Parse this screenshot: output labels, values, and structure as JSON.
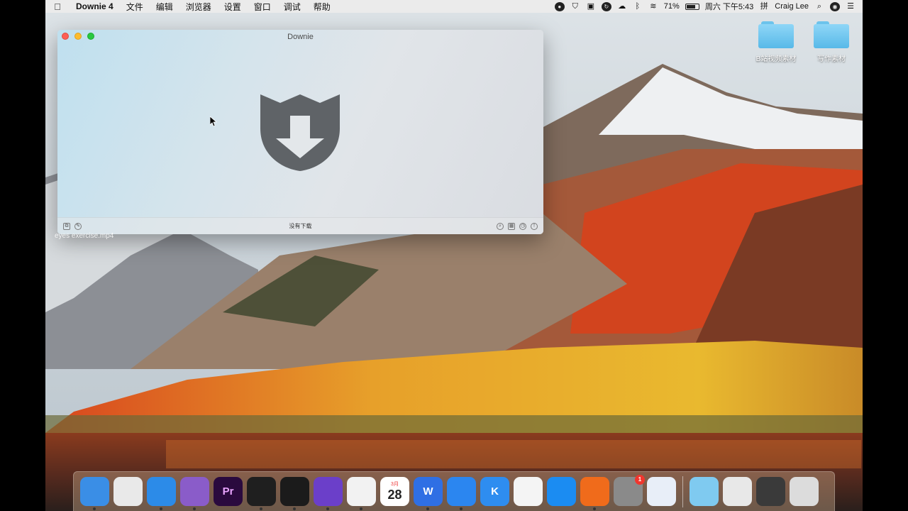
{
  "menubar": {
    "app_name": "Downie 4",
    "items": [
      "文件",
      "编辑",
      "浏览器",
      "设置",
      "窗口",
      "调试",
      "帮助"
    ],
    "battery_percent": "71%",
    "datetime": "周六 下午5:43",
    "user": "Craig Lee"
  },
  "desktop": {
    "folders": [
      {
        "label": "B站视频素材"
      },
      {
        "label": "写作素材"
      }
    ],
    "file_label": "eyes exercise.mp4"
  },
  "window": {
    "title": "Downie",
    "status": "没有下载"
  },
  "dock": {
    "apps": [
      {
        "name": "finder-icon",
        "color": "#3a8ee6"
      },
      {
        "name": "chrome-icon",
        "color": "#e9e9e9"
      },
      {
        "name": "safari-icon",
        "color": "#2c8be8"
      },
      {
        "name": "downie-icon",
        "color": "#8a5cc9"
      },
      {
        "name": "premiere-icon",
        "color": "#2a0a3e",
        "text": "Pr"
      },
      {
        "name": "video-camera-icon",
        "color": "#1f1f1f"
      },
      {
        "name": "quicktime-icon",
        "color": "#1b1b1b"
      },
      {
        "name": "imovie-icon",
        "color": "#6b3fc9"
      },
      {
        "name": "qq-icon",
        "color": "#f2f2f2"
      },
      {
        "name": "calendar-icon",
        "color": "#ffffff",
        "month": "3月",
        "day": "28"
      },
      {
        "name": "wps-icon",
        "color": "#2f6fe4",
        "text": "W"
      },
      {
        "name": "feishu-icon",
        "color": "#2b86f0"
      },
      {
        "name": "klook-icon",
        "color": "#2e8df0",
        "text": "K"
      },
      {
        "name": "baidu-netdisk-icon",
        "color": "#f4f4f4"
      },
      {
        "name": "app-store-icon",
        "color": "#1b8cf2"
      },
      {
        "name": "infuse-icon",
        "color": "#f06b1b"
      },
      {
        "name": "system-preferences-icon",
        "color": "#8a8a8a",
        "badge": "1"
      },
      {
        "name": "airmail-icon",
        "color": "#e8eef8"
      }
    ],
    "stacks": [
      {
        "name": "downloads-stack-icon",
        "color": "#7fcaf0"
      },
      {
        "name": "documents-stack-icon",
        "color": "#e8e8e8"
      },
      {
        "name": "screenshots-stack-icon",
        "color": "#3a3a3a"
      },
      {
        "name": "trash-icon",
        "color": "#dcdcdc"
      }
    ]
  }
}
